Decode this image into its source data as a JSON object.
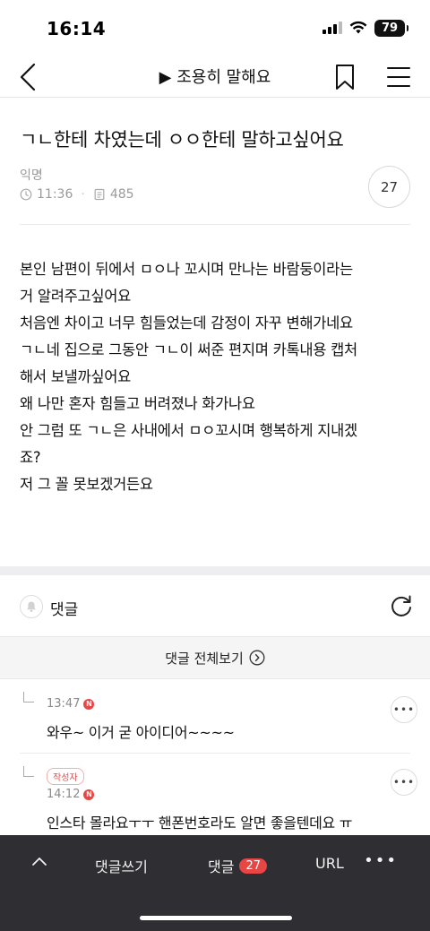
{
  "status_bar": {
    "time": "16:14",
    "battery": "79"
  },
  "nav": {
    "title": "▶ 조용히 말해요"
  },
  "post": {
    "title": "ㄱㄴ한테 차였는데 ㅇㅇ한테 말하고싶어요",
    "author": "익명",
    "time": "11:36",
    "views": "485",
    "comment_count": "27",
    "body_lines": [
      "본인 남편이 뒤에서 ㅁㅇ나 꼬시며 만나는 바람둥이라는",
      "거 알려주고싶어요",
      "처음엔 차이고 너무 힘들었는데 감정이 자꾸 변해가네요",
      "ㄱㄴ네 집으로 그동안 ㄱㄴ이 써준 편지며 카톡내용 캡처",
      "해서 보낼까싶어요",
      "왜 나만 혼자 힘들고 버려졌나 화가나요",
      "안 그럼 또 ㄱㄴ은 사내에서 ㅁㅇ꼬시며 행복하게 지내겠",
      "죠?",
      "저 그 꼴 못보겠거든요"
    ]
  },
  "comments_section": {
    "label": "댓글",
    "view_all": "댓글 전체보기",
    "items": [
      {
        "time": "13:47",
        "new_badge": "N",
        "text": "와우~ 이거 굳 아이디어~~~~"
      },
      {
        "author_badge": "작성자",
        "time": "14:12",
        "new_badge": "N",
        "text": "인스타 몰라요ㅜㅜ 핸폰번호라도 알면 좋을텐데요 ㅠ"
      }
    ]
  },
  "bottom_bar": {
    "write_label": "댓글쓰기",
    "comments_label": "댓글",
    "comments_count": "27",
    "url_label": "URL",
    "more_label": "•••"
  },
  "colors": {
    "accent_red": "#e84545",
    "bottom_bar_bg": "#2f2f33"
  }
}
